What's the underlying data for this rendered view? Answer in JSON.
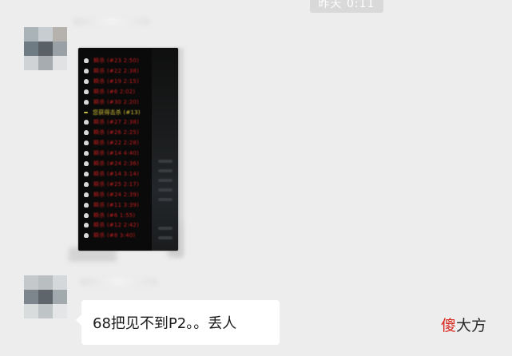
{
  "timestamp": "昨天 0:11",
  "colors": {
    "chat_background": "#ededed",
    "bubble_background": "#ffffff",
    "kill_text": "#c41e1e",
    "highlight_text": "#d8c63a",
    "watermark_accent": "#d9261c"
  },
  "messages": [
    {
      "sender_name": "",
      "type": "image",
      "kill_feed": [
        {
          "icon": "skull-icon",
          "text": "瞬杀 (#23 2:50)"
        },
        {
          "icon": "skull-icon",
          "text": "瞬杀 (#22 2:38)"
        },
        {
          "icon": "skull-icon",
          "text": "瞬杀 (#19 2:15)"
        },
        {
          "icon": "skull-icon",
          "text": "瞬杀 (#6 2:02)"
        },
        {
          "icon": "skull-icon",
          "text": "瞬杀 (#30 2:20)"
        },
        {
          "icon": "dash-icon",
          "text": "您获得击杀 (#13)",
          "highlight": true
        },
        {
          "icon": "skull-icon",
          "text": "瞬杀 (#27 2:38)"
        },
        {
          "icon": "skull-icon",
          "text": "瞬杀 (#26 2:25)"
        },
        {
          "icon": "skull-icon",
          "text": "瞬杀 (#22 2:28)"
        },
        {
          "icon": "skull-icon",
          "text": "瞬杀 (#14 4:40)"
        },
        {
          "icon": "skull-icon",
          "text": "瞬杀 (#24 2:36)"
        },
        {
          "icon": "skull-icon",
          "text": "瞬杀 (#14 3:14)"
        },
        {
          "icon": "skull-icon",
          "text": "瞬杀 (#25 2:17)"
        },
        {
          "icon": "skull-icon",
          "text": "瞬杀 (#24 2:39)"
        },
        {
          "icon": "skull-icon",
          "text": "瞬杀 (#11 3:39)"
        },
        {
          "icon": "skull-icon",
          "text": "瞬杀 (#6 1:55)"
        },
        {
          "icon": "skull-icon",
          "text": "瞬杀 (#12 2:42)"
        },
        {
          "icon": "skull-icon",
          "text": "瞬杀 (#8 3:40)"
        }
      ]
    },
    {
      "sender_name": "",
      "type": "text",
      "text": "68把见不到P2。。丢人"
    }
  ],
  "watermark": {
    "accent_char": "傻",
    "rest": "大方"
  }
}
